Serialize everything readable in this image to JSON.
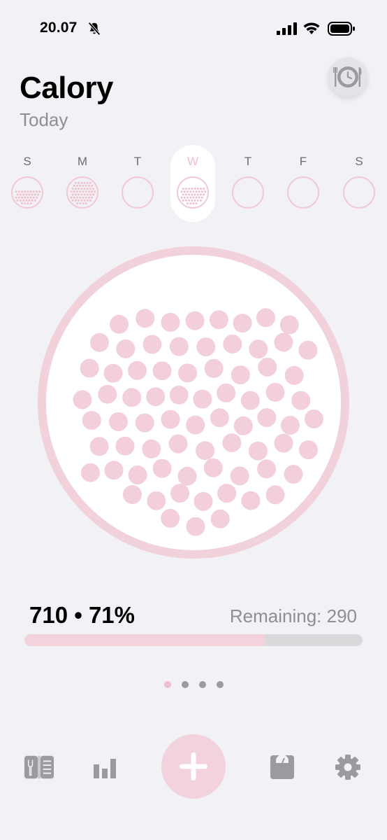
{
  "status_bar": {
    "time": "20.07"
  },
  "header": {
    "title": "Calory",
    "subtitle": "Today"
  },
  "week": {
    "days": [
      {
        "letter": "S",
        "fill": 0.55
      },
      {
        "letter": "M",
        "fill": 0.9
      },
      {
        "letter": "T",
        "fill": 0
      },
      {
        "letter": "W",
        "fill": 0.71,
        "selected": true
      },
      {
        "letter": "T",
        "fill": 0
      },
      {
        "letter": "F",
        "fill": 0
      },
      {
        "letter": "S",
        "fill": 0
      }
    ]
  },
  "summary": {
    "consumed_text": "710 • 71%",
    "remaining_text": "Remaining: 290",
    "progress": 0.71
  },
  "pager": {
    "count": 4,
    "active": 0
  },
  "tab_bar": {
    "icons": [
      "menu-book-icon",
      "bar-chart-icon",
      "add-icon",
      "scale-icon",
      "gear-icon"
    ]
  },
  "colors": {
    "accent": "#f1d1da",
    "dot": "#f2cfd9",
    "background": "#f2f1f6",
    "muted": "#8e8e93"
  }
}
